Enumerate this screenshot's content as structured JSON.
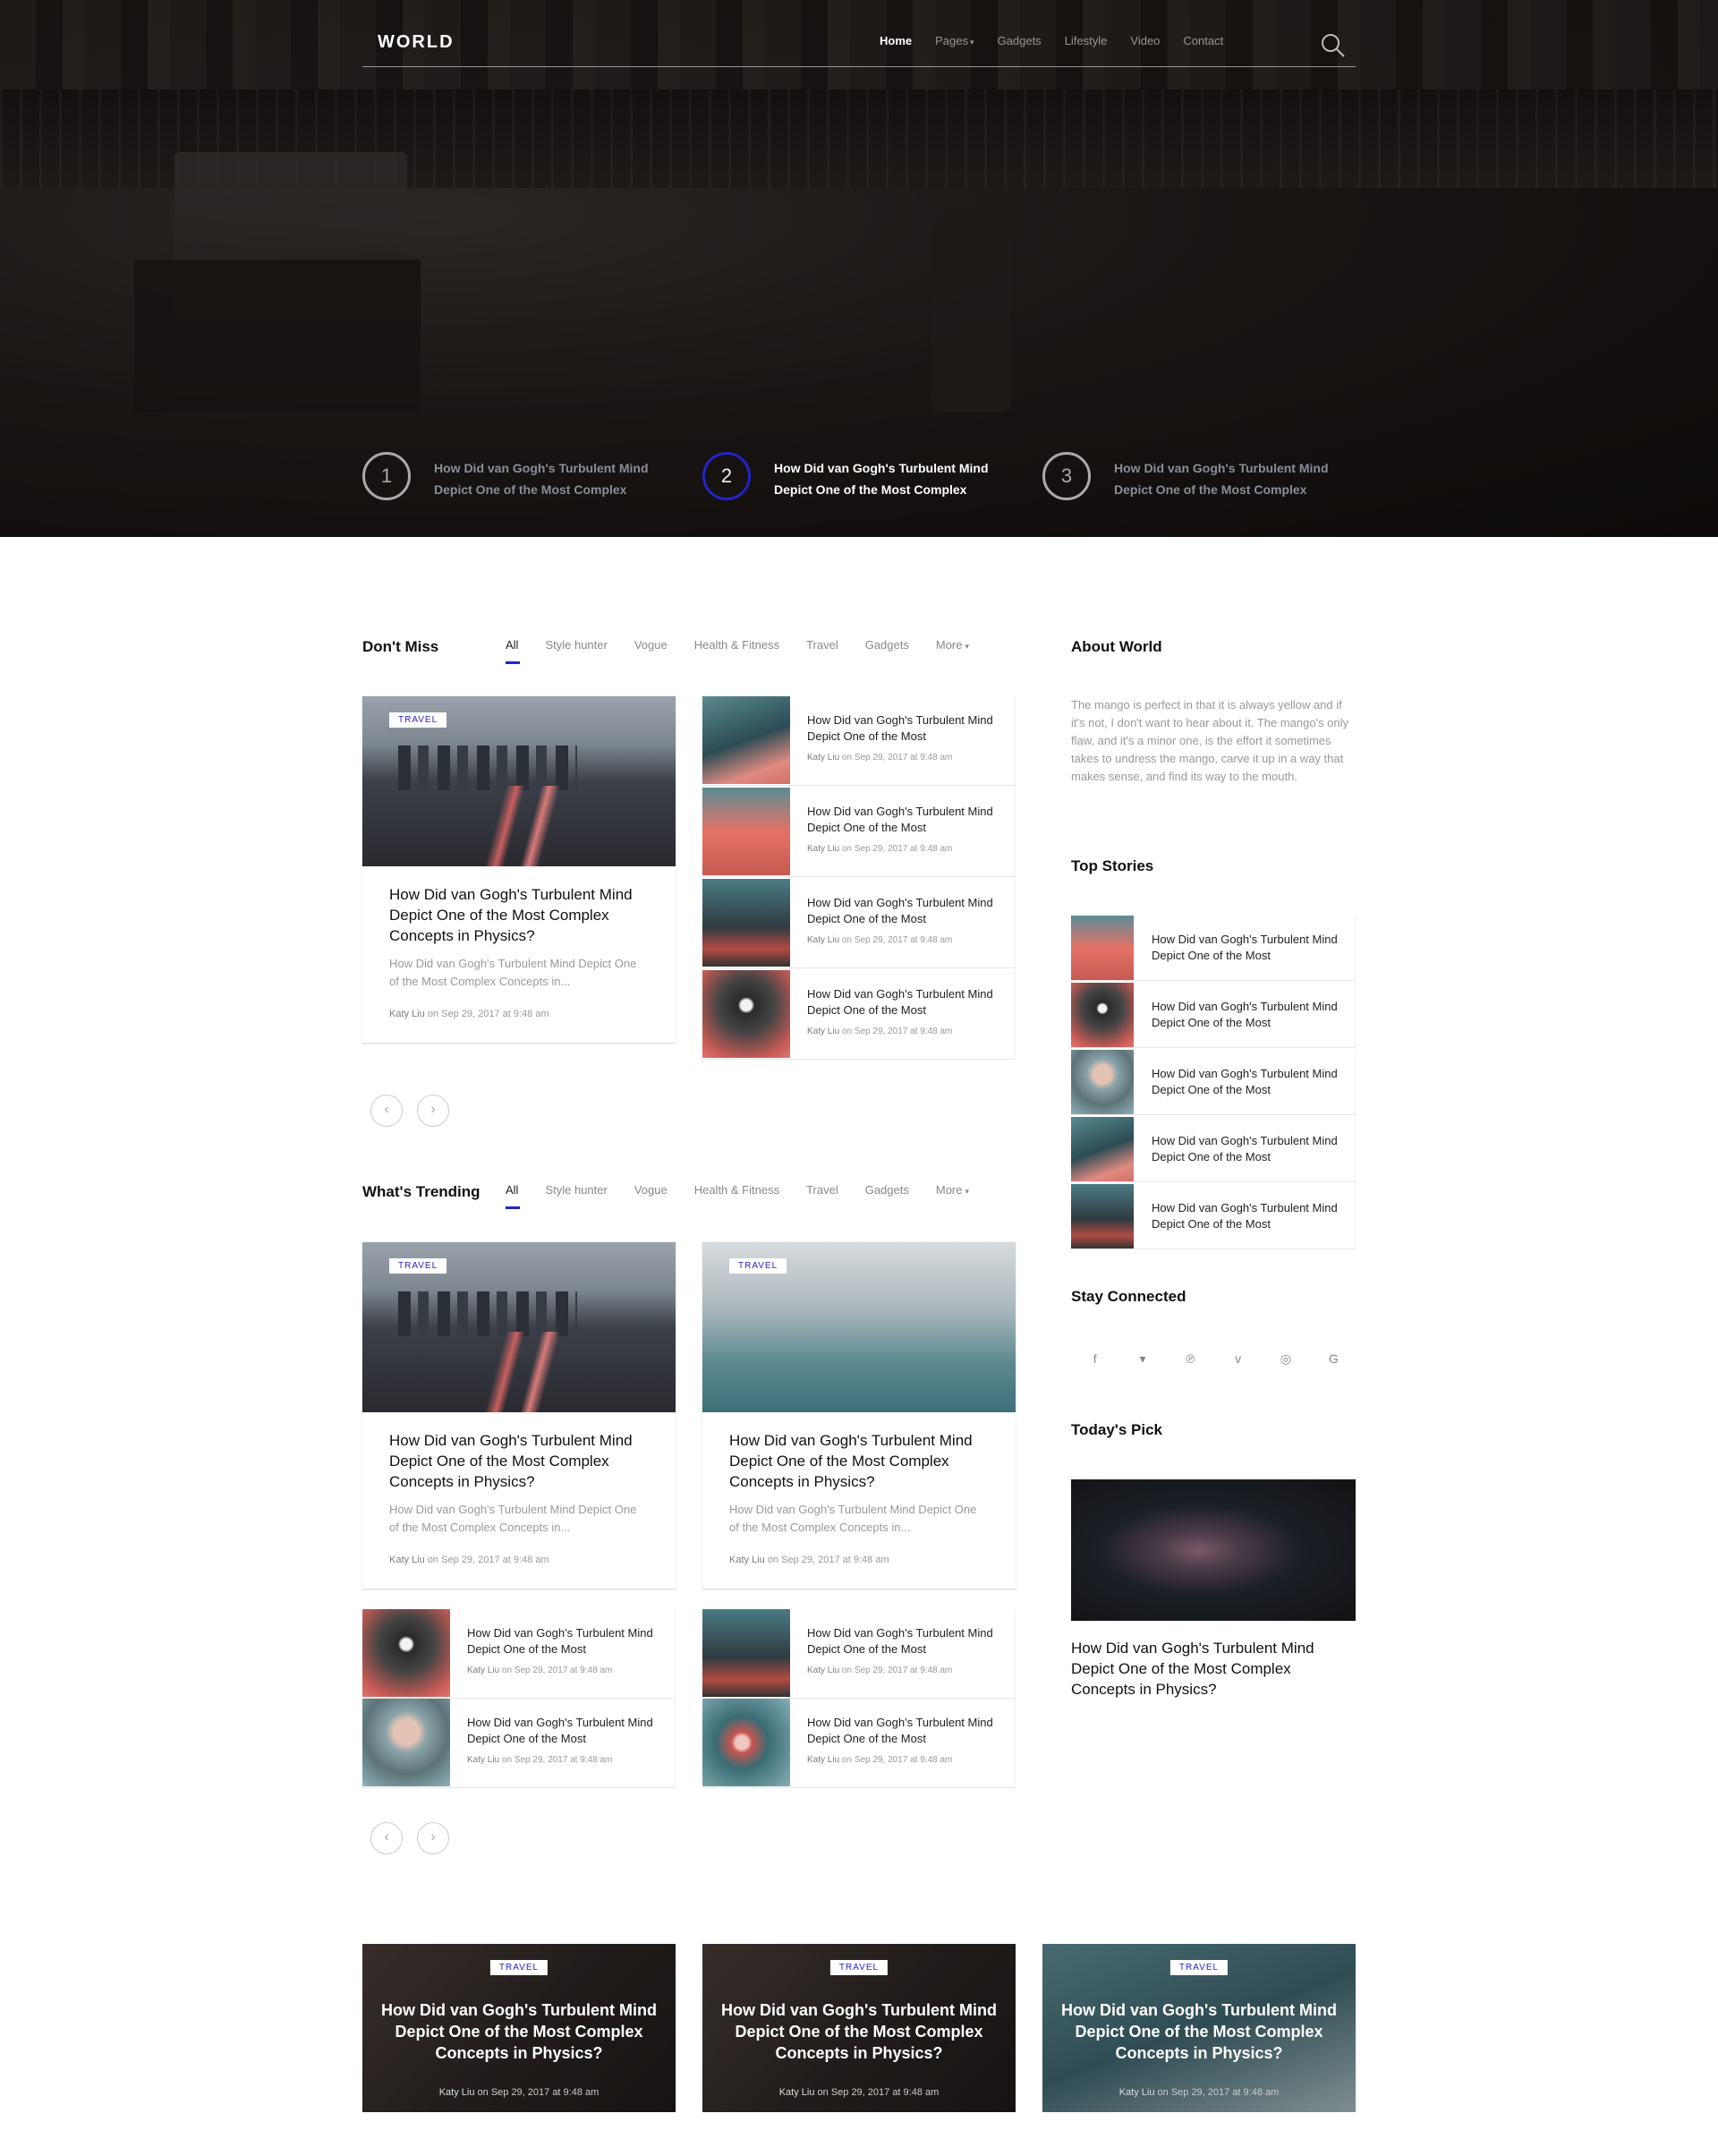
{
  "nav": {
    "logo": "WORLD",
    "items": [
      {
        "label": "Home",
        "active": true
      },
      {
        "label": "Pages",
        "caret": true
      },
      {
        "label": "Gadgets"
      },
      {
        "label": "Lifestyle"
      },
      {
        "label": "Video"
      },
      {
        "label": "Contact"
      }
    ],
    "search_icon": "search-icon"
  },
  "hero": {
    "slides": [
      {
        "num": "1",
        "title": "How Did van Gogh's Turbulent Mind Depict One of the Most Complex"
      },
      {
        "num": "2",
        "title": "How Did van Gogh's Turbulent Mind Depict One of the Most Complex"
      },
      {
        "num": "3",
        "title": "How Did van Gogh's Turbulent Mind Depict One of the Most Complex"
      }
    ]
  },
  "tabs": [
    "All",
    "Style hunter",
    "Vogue",
    "Health & Fitness",
    "Travel",
    "Gadgets",
    "More"
  ],
  "badge": "TRAVEL",
  "article": {
    "title": "How Did van Gogh's Turbulent Mind Depict One of the Most Complex Concepts in Physics?",
    "short_title": "How Did van Gogh's Turbulent Mind Depict One of the Most",
    "excerpt": "How Did van Gogh's Turbulent Mind Depict One of the Most Complex Concepts in...",
    "author": "Katy Liu",
    "on": "on",
    "date": "Sep 29, 2017 at 9:48 am"
  },
  "dont_miss": {
    "title": "Don't Miss"
  },
  "trending": {
    "title": "What's Trending"
  },
  "about": {
    "title": "About World",
    "text": "The mango is perfect in that it is always yellow and if it's not, I don't want to hear about it. The mango's only flaw, and it's a minor one, is the effort it sometimes takes to undress the mango, carve it up in a way that makes sense, and find its way to the mouth."
  },
  "top_stories": {
    "title": "Top Stories"
  },
  "stay_connected": {
    "title": "Stay Connected",
    "icons": [
      "facebook-icon",
      "twitter-icon",
      "pinterest-icon",
      "vimeo-icon",
      "instagram-icon",
      "google-icon"
    ],
    "glyphs": [
      "f",
      "▾",
      "℗",
      "v",
      "◎",
      "G"
    ]
  },
  "todays_pick": {
    "title": "Today's Pick",
    "headline": "How Did van Gogh's Turbulent Mind Depict One of the Most Complex Concepts in Physics?"
  },
  "featured": {
    "title": "How Did van Gogh's Turbulent Mind Depict One of the Most Complex Concepts in Physics?"
  }
}
